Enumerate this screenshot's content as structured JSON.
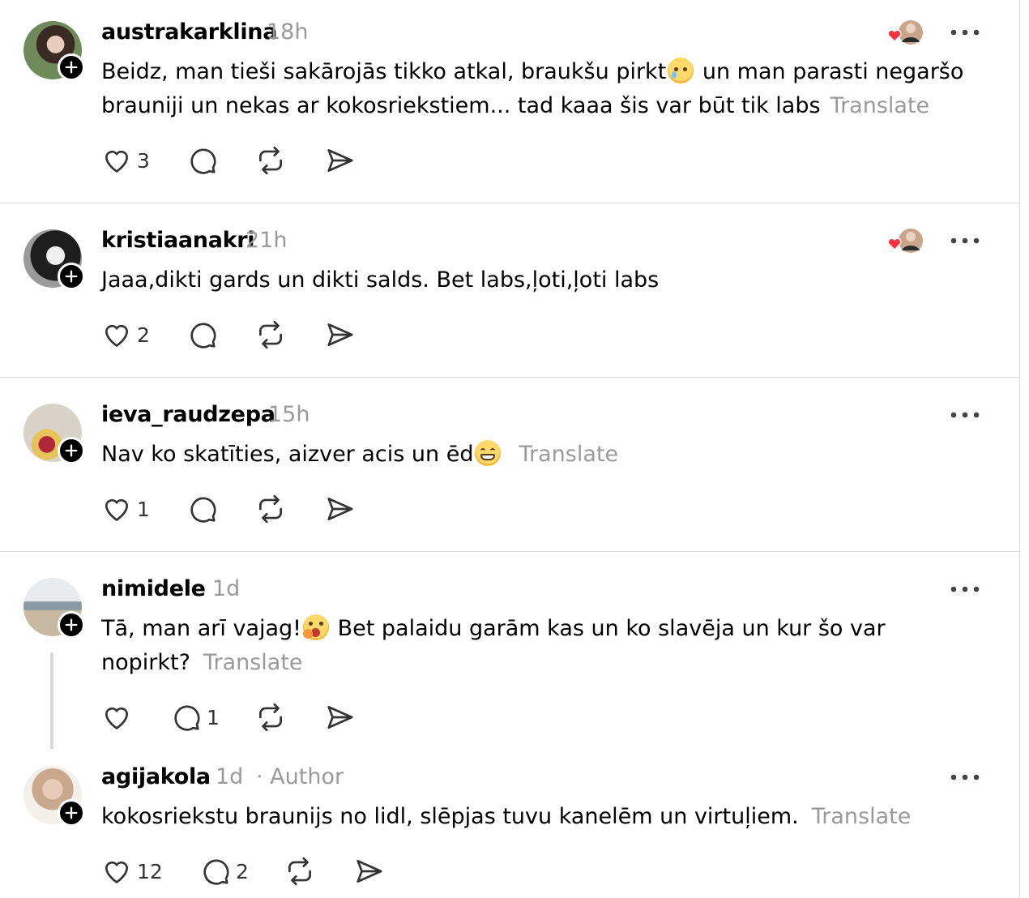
{
  "posts": [
    {
      "username": "austrakarklina",
      "time": "18h",
      "text_line1": "Beidz, man tieši sakārojās tikko atkal, braukšu pirkt",
      "text_line1_after_emoji": " un man parasti negaršo",
      "text_line2": "brauniji un nekas ar kokosriekstiem... tad kaaa šis var būt tik labs",
      "translate": "Translate",
      "likes": "3",
      "emoji": "face-holding-back-tears"
    },
    {
      "username": "kristiaanakri",
      "time": "21h",
      "text": "Jaaa,dikti gards un dikti salds. Bet labs,ļoti,ļoti labs",
      "likes": "2"
    },
    {
      "username": "ieva_raudzepa",
      "time": "15h",
      "text": "Nav ko skatīties, aizver acis un ēd",
      "translate": "Translate",
      "likes": "1",
      "emoji": "grinning-face"
    },
    {
      "username": "nimidele",
      "time": "1d",
      "text_line1": "Tā, man arī vajag!",
      "text_line1_after_emoji": " Bet palaidu garām kas un ko slavēja un kur šo var",
      "text_line2": "nopirkt?",
      "translate": "Translate",
      "replies": "1",
      "emoji": "face-with-hand-over-mouth"
    },
    {
      "username": "agijakola",
      "time": "1d",
      "author_tag": "· Author",
      "text": "kokosriekstu braunijs no lidl, slēpjas tuvu kanelēm un virtuļiem.",
      "translate": "Translate",
      "likes": "12",
      "replies": "2"
    }
  ],
  "icons": {
    "like": "heart-outline-icon",
    "reply": "speech-bubble-icon",
    "repost": "repost-arrows-icon",
    "share": "send-paper-plane-icon",
    "more": "ellipsis-icon",
    "follow": "plus-icon",
    "liked_by": "red-heart-with-avatar"
  },
  "colors": {
    "muted_text": "#9a9a9a",
    "divider": "#dcdcdc",
    "liked_heart": "#ff3040"
  }
}
